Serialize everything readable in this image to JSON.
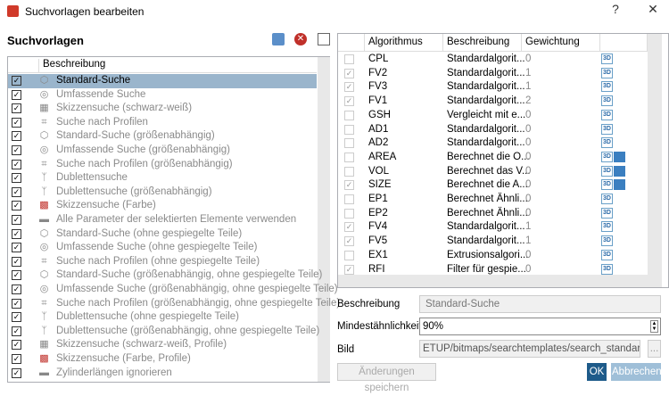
{
  "window": {
    "title": "Suchvorlagen bearbeiten",
    "help": "?",
    "close": "✕"
  },
  "left": {
    "heading": "Suchvorlagen",
    "column": "Beschreibung",
    "items": [
      {
        "label": "Standard-Suche",
        "icon": "cube",
        "selected": true
      },
      {
        "label": "Umfassende Suche",
        "icon": "cylinder"
      },
      {
        "label": "Skizzensuche (schwarz-weiß)",
        "icon": "sketch"
      },
      {
        "label": "Suche nach Profilen",
        "icon": "profile"
      },
      {
        "label": "Standard-Suche (größenabhängig)",
        "icon": "cube"
      },
      {
        "label": "Umfassende Suche (größenabhängig)",
        "icon": "cylinder"
      },
      {
        "label": "Suche nach Profilen (größenabhängig)",
        "icon": "profile"
      },
      {
        "label": "Dublettensuche",
        "icon": "duplicate"
      },
      {
        "label": "Dublettensuche (größenabhängig)",
        "icon": "duplicate"
      },
      {
        "label": "Skizzensuche (Farbe)",
        "icon": "sketch-color"
      },
      {
        "label": "Alle Parameter der selektierten Elemente verwenden",
        "icon": "parameters"
      },
      {
        "label": "Standard-Suche (ohne gespiegelte Teile)",
        "icon": "cube"
      },
      {
        "label": "Umfassende Suche (ohne gespiegelte Teile)",
        "icon": "cylinder"
      },
      {
        "label": "Suche nach Profilen (ohne gespiegelte Teile)",
        "icon": "profile"
      },
      {
        "label": "Standard-Suche (größenabhängig, ohne gespiegelte Teile)",
        "icon": "cube"
      },
      {
        "label": "Umfassende Suche (größenabhängig, ohne gespiegelte Teile)",
        "icon": "cylinder"
      },
      {
        "label": "Suche nach Profilen (größenabhängig, ohne gespiegelte Teile)",
        "icon": "profile"
      },
      {
        "label": "Dublettensuche (ohne gespiegelte Teile)",
        "icon": "duplicate"
      },
      {
        "label": "Dublettensuche (größenabhängig, ohne gespiegelte Teile)",
        "icon": "duplicate"
      },
      {
        "label": "Skizzensuche (schwarz-weiß, Profile)",
        "icon": "sketch"
      },
      {
        "label": "Skizzensuche (Farbe, Profile)",
        "icon": "sketch-color"
      },
      {
        "label": "Zylinderlängen ignorieren",
        "icon": "parameters"
      }
    ]
  },
  "grid": {
    "columns": [
      "Algorithmus",
      "Beschreibung",
      "Gewichtung"
    ],
    "badge": "3D",
    "rows": [
      {
        "c": false,
        "a": "CPL",
        "d": "Standardalgorit...",
        "w": "0",
        "size": false
      },
      {
        "c": true,
        "a": "FV2",
        "d": "Standardalgorit...",
        "w": "1",
        "size": false
      },
      {
        "c": true,
        "a": "FV3",
        "d": "Standardalgorit...",
        "w": "1",
        "size": false
      },
      {
        "c": true,
        "a": "FV1",
        "d": "Standardalgorit...",
        "w": "2",
        "size": false
      },
      {
        "c": false,
        "a": "GSH",
        "d": "Vergleicht mit e...",
        "w": "0",
        "size": false
      },
      {
        "c": false,
        "a": "AD1",
        "d": "Standardalgorit...",
        "w": "0",
        "size": false
      },
      {
        "c": false,
        "a": "AD2",
        "d": "Standardalgorit...",
        "w": "0",
        "size": false
      },
      {
        "c": false,
        "a": "AREA",
        "d": "Berechnet die O...",
        "w": "0",
        "size": true
      },
      {
        "c": false,
        "a": "VOL",
        "d": "Berechnet das V...",
        "w": "0",
        "size": true
      },
      {
        "c": true,
        "a": "SIZE",
        "d": "Berechnet die A...",
        "w": "0",
        "size": true
      },
      {
        "c": false,
        "a": "EP1",
        "d": "Berechnet Ähnli...",
        "w": "0",
        "size": false
      },
      {
        "c": false,
        "a": "EP2",
        "d": "Berechnet Ähnli...",
        "w": "0",
        "size": false
      },
      {
        "c": true,
        "a": "FV4",
        "d": "Standardalgorit...",
        "w": "1",
        "size": false
      },
      {
        "c": true,
        "a": "FV5",
        "d": "Standardalgorit...",
        "w": "1",
        "size": false
      },
      {
        "c": false,
        "a": "EX1",
        "d": "Extrusionsalgori...",
        "w": "0",
        "size": false
      },
      {
        "c": true,
        "a": "RFI",
        "d": "Filter für gespie...",
        "w": "0",
        "size": false
      }
    ]
  },
  "form": {
    "desc_label": "Beschreibung",
    "desc_value": "Standard-Suche",
    "sim_label": "Mindestähnlichkeit",
    "sim_value": "90%",
    "img_label": "Bild",
    "img_value": "ETUP/bitmaps/searchtemplates/search_standard.png",
    "browse": "..."
  },
  "buttons": {
    "save": "Änderungen speichern",
    "ok": "OK",
    "cancel": "Abbrechen"
  }
}
